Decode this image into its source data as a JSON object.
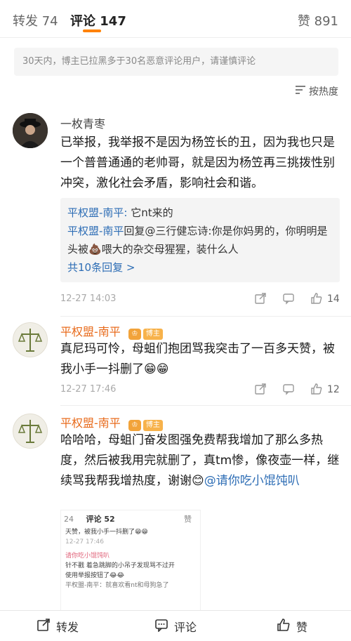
{
  "tabs": {
    "repost_label": "转发",
    "repost_count": "74",
    "comment_label": "评论",
    "comment_count": "147",
    "like_label": "赞",
    "like_count": "891"
  },
  "notice": "30天内，博主已拉黑多于30名恶意评论用户，请谨慎评论",
  "sort_label": "按热度",
  "comments": [
    {
      "username": "一枚青枣",
      "text": "已举报，我举报不是因为杨笠长的丑，因为我也只是一个普普通通的老帅哥，就是因为杨笠再三挑拨性别冲突，激化社会矛盾，影响社会和谐。",
      "replies": [
        {
          "name": "平权盟-南平:",
          "text": " 它nt来的"
        },
        {
          "name": "平权盟-南平",
          "text": "回复@三行健忘诗:你是你妈男的，你明明是头被💩喂大的杂交母猩猩，装什么人"
        }
      ],
      "more_replies": "共10条回复 >",
      "time": "12-27 14:03",
      "likes": "14"
    },
    {
      "username": "平权盟-南平",
      "badge": "博主",
      "text": "真尼玛可怜，母蛆们抱团骂我突击了一百多天赞，被我小手一抖删了😁😁",
      "time": "12-27 17:46",
      "likes": "12"
    },
    {
      "username": "平权盟-南平",
      "badge": "博主",
      "text": "哈哈哈，母蛆门奋发图强免费帮我增加了那么多热度，然后被我用完就删了，真tm惨，像夜壶一样，继续骂我帮我增热度，谢谢😊",
      "mention": "@请你吃小馄饨叭"
    }
  ],
  "embedded": {
    "count": "24",
    "label": "评论 52",
    "right": "赞",
    "line1": "天赞，被我小手一抖删了😁😁",
    "line2": "12-27 17:46",
    "line3": "请你吃小馄饨叭",
    "line4": "针不戳 着急跳脚的小吊子发现骂不过开",
    "line5": "使用举报按钮了😂😂",
    "line6": "平权盟-南平：就喜欢看nt和母狗急了"
  },
  "bottom": {
    "repost": "转发",
    "comment": "评论",
    "like": "赞"
  }
}
